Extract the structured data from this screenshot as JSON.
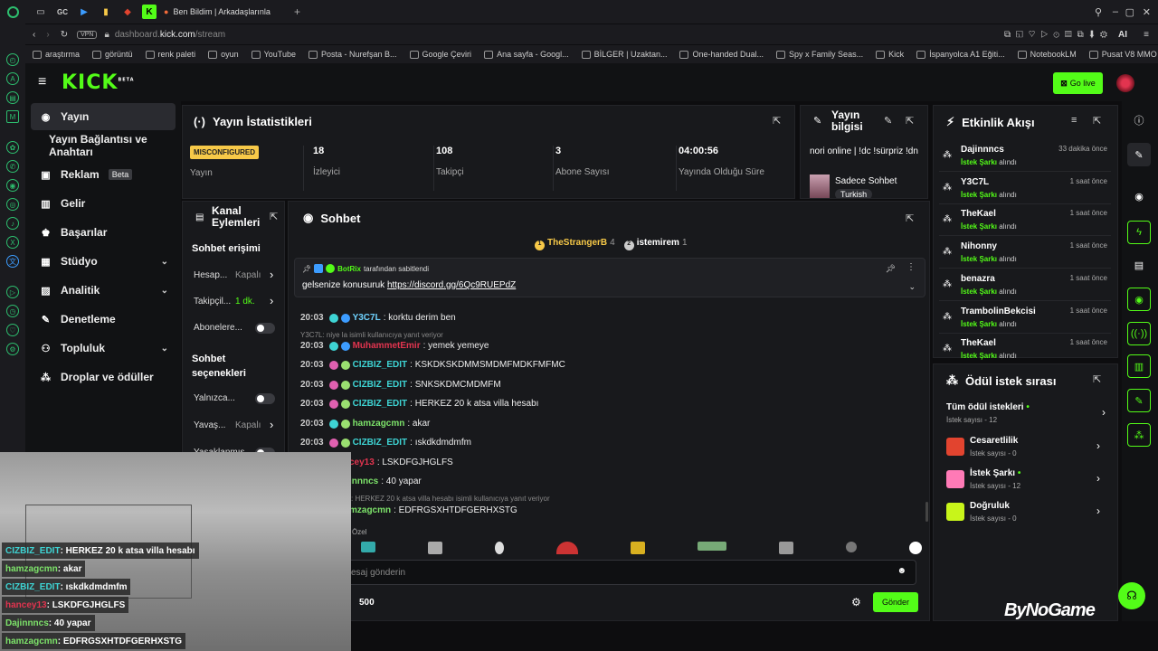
{
  "browser": {
    "tab_title": "Ben Bildim | Arkadaşlarınla",
    "tab_small_labels": [
      "GC"
    ],
    "url_prefix": "dashboard.",
    "url_domain": "kick.com",
    "url_path": "/stream",
    "vpn": "VPN",
    "ai": "AI",
    "bookmarks": [
      "araştırma",
      "görüntü",
      "renk paleti",
      "oyun",
      "YouTube",
      "Posta - Nurefşan B...",
      "Google Çeviri",
      "Ana sayfa - Googl...",
      "BİLGER | Uzaktan...",
      "One-handed Dual...",
      "Spy x Family Seas...",
      "Kick",
      "İspanyolca A1 Eğiti...",
      "NotebookLM",
      "Pusat V8 MMO Oy..."
    ]
  },
  "kick": {
    "logo": "KICK",
    "logo_badge": "BETA",
    "go_live": "Go live"
  },
  "sidebar": {
    "items": [
      {
        "label": "Yayın",
        "icon": "broadcast-icon"
      },
      {
        "label": "Yayın Bağlantısı ve Anahtarı",
        "icon": ""
      },
      {
        "label": "Reklam",
        "icon": "ad-icon",
        "badge": "Beta"
      },
      {
        "label": "Gelir",
        "icon": "chart-icon"
      },
      {
        "label": "Başarılar",
        "icon": "trophy-icon"
      },
      {
        "label": "Stüdyo",
        "icon": "studio-icon"
      },
      {
        "label": "Analitik",
        "icon": "analytics-icon"
      },
      {
        "label": "Denetleme",
        "icon": "hammer-icon"
      },
      {
        "label": "Topluluk",
        "icon": "community-icon"
      },
      {
        "label": "Droplar ve ödüller",
        "icon": "drops-icon"
      }
    ]
  },
  "stats": {
    "title": "Yayın İstatistikleri",
    "status_badge": "MISCONFIGURED",
    "status_label": "Yayın",
    "items": [
      {
        "value": "18",
        "label": "İzleyici"
      },
      {
        "value": "108",
        "label": "Takipçi"
      },
      {
        "value": "3",
        "label": "Abone Sayısı"
      },
      {
        "value": "04:00:56",
        "label": "Yayında Olduğu Süre"
      }
    ]
  },
  "stream_info": {
    "title_line1": "Yayın",
    "title_line2": "bilgisi",
    "stream_title": "nori online | !dc !sürpriz !dn",
    "category": "Sadece Sohbet",
    "tag": "Turkish"
  },
  "channel_actions": {
    "title_line1": "Kanal",
    "title_line2": "Eylemleri",
    "section1": "Sohbet erişimi",
    "rows": [
      {
        "label": "Hesap...",
        "value": "Kapalı"
      },
      {
        "label": "Takipçil...",
        "value": "1 dk."
      },
      {
        "label": "Abonelere...",
        "value": ""
      }
    ],
    "section2_line1": "Sohbet",
    "section2_line2": "seçenekleri",
    "rows2": [
      {
        "label": "Yalnızca...",
        "value": ""
      },
      {
        "label": "Yavaş...",
        "value": "Kapalı"
      },
      {
        "label": "Yasaklanmış...",
        "value": ""
      }
    ]
  },
  "chat": {
    "title": "Sohbet",
    "top_users": [
      {
        "name": "TheStrangerB",
        "count": "4"
      },
      {
        "name": "istemirem",
        "count": "1"
      }
    ],
    "pinned_by": "BotRix",
    "pinned_text": "tarafından sabitlendi",
    "pinned_msg_prefix": "gelsenize konusuruk",
    "pinned_link": "https://discord.gg/6Qc9RUEPdZ",
    "messages": [
      {
        "time": "20:03",
        "user": "Y3C7L",
        "color": "#6fd3ff",
        "text": ": korktu derim ben"
      },
      {
        "reply": "Y3C7L: niye la isimli kullanıcıya yanıt veriyor"
      },
      {
        "time": "20:03",
        "user": "MuhammetEmir",
        "color": "#e2344f",
        "text": ": yemek yemeye"
      },
      {
        "time": "20:03",
        "user": "CIZBIZ_EDIT",
        "color": "#3ed4d4",
        "text": ": KSKDKSKDMMSMDMFMDKFMFMC"
      },
      {
        "time": "20:03",
        "user": "CIZBIZ_EDIT",
        "color": "#3ed4d4",
        "text": ": SNKSKDMCMDMFM"
      },
      {
        "time": "20:03",
        "user": "CIZBIZ_EDIT",
        "color": "#3ed4d4",
        "text": ": HERKEZ 20 k atsa villa hesabı"
      },
      {
        "time": "20:03",
        "user": "hamzagcmn",
        "color": "#7de36a",
        "text": ": akar"
      },
      {
        "time": "20:03",
        "user": "CIZBIZ_EDIT",
        "color": "#3ed4d4",
        "text": ": ıskdkdmdmfm"
      },
      {
        "time": "",
        "user": "cey13",
        "color": "#e2344f",
        "text": ": LSKDFGJHGLFS"
      },
      {
        "time": "",
        "user": "innncs",
        "color": "#7de36a",
        "text": ": 40 yapar"
      },
      {
        "reply": ": HERKEZ 20 k atsa villa hesabı isimli kullanıcıya yanıt veriyor"
      },
      {
        "time": "",
        "user": "mzagcmn",
        "color": "#7de36a",
        "text": ": EDFRGSXHTDFGERHXSTG"
      }
    ],
    "emote_section": "Özel",
    "input_placeholder": "esaj gönderin",
    "points": "500",
    "send": "Gönder"
  },
  "events": {
    "title": "Etkinlik Akışı",
    "items": [
      {
        "name": "Dajinnncs",
        "sub_green": "İstek Şarkı",
        "sub": " alındı",
        "time": "33 dakika önce"
      },
      {
        "name": "Y3C7L",
        "sub_green": "İstek Şarkı",
        "sub": " alındı",
        "time": "1 saat önce"
      },
      {
        "name": "TheKael",
        "sub_green": "İstek Şarkı",
        "sub": " alındı",
        "time": "1 saat önce"
      },
      {
        "name": "Nihonny",
        "sub_green": "İstek Şarkı",
        "sub": " alındı",
        "time": "1 saat önce"
      },
      {
        "name": "benazra",
        "sub_green": "İstek Şarkı",
        "sub": " alındı",
        "time": "1 saat önce"
      },
      {
        "name": "TrambolinBekcisi",
        "sub_green": "İstek Şarkı",
        "sub": " alındı",
        "time": "1 saat önce"
      },
      {
        "name": "TheKael",
        "sub_green": "İstek Şarkı",
        "sub": " alındı",
        "time": "1 saat önce"
      }
    ]
  },
  "rewards": {
    "title": "Ödül istek sırası",
    "all": "Tüm ödül istekleri",
    "all_sub": "İstek sayısı - 12",
    "items": [
      {
        "name": "Cesaretlilik",
        "sub": "İstek sayısı - 0",
        "color": "#e2442f"
      },
      {
        "name": "İstek Şarkı",
        "sub": "İstek sayısı - 12",
        "color": "#ff7ab6"
      },
      {
        "name": "Doğruluk",
        "sub": "İstek sayısı - 0",
        "color": "#c8f51a"
      }
    ]
  },
  "overlay": {
    "lines": [
      {
        "user": "CIZBIZ_EDIT",
        "color": "#3ed4d4",
        "text": " : HERKEZ 20 k atsa villa hesabı"
      },
      {
        "user": "hamzagcmn",
        "color": "#7de36a",
        "text": " : akar"
      },
      {
        "user": "CIZBIZ_EDIT",
        "color": "#3ed4d4",
        "text": " : ıskdkdmdmfm"
      },
      {
        "user": "hancey13",
        "color": "#e2344f",
        "text": " : LSKDFGJHGLFS"
      },
      {
        "user": "Dajinnncs",
        "color": "#7de36a",
        "text": " : 40 yapar"
      },
      {
        "user": "hamzagcmn",
        "color": "#7de36a",
        "text": " : EDFRGSXHTDFGERHXSTG"
      }
    ]
  },
  "watermark": "ByNoGame",
  "colors": {
    "kick_green": "#53fc18",
    "panel": "#18191c",
    "bg": "#0d0d0f"
  }
}
